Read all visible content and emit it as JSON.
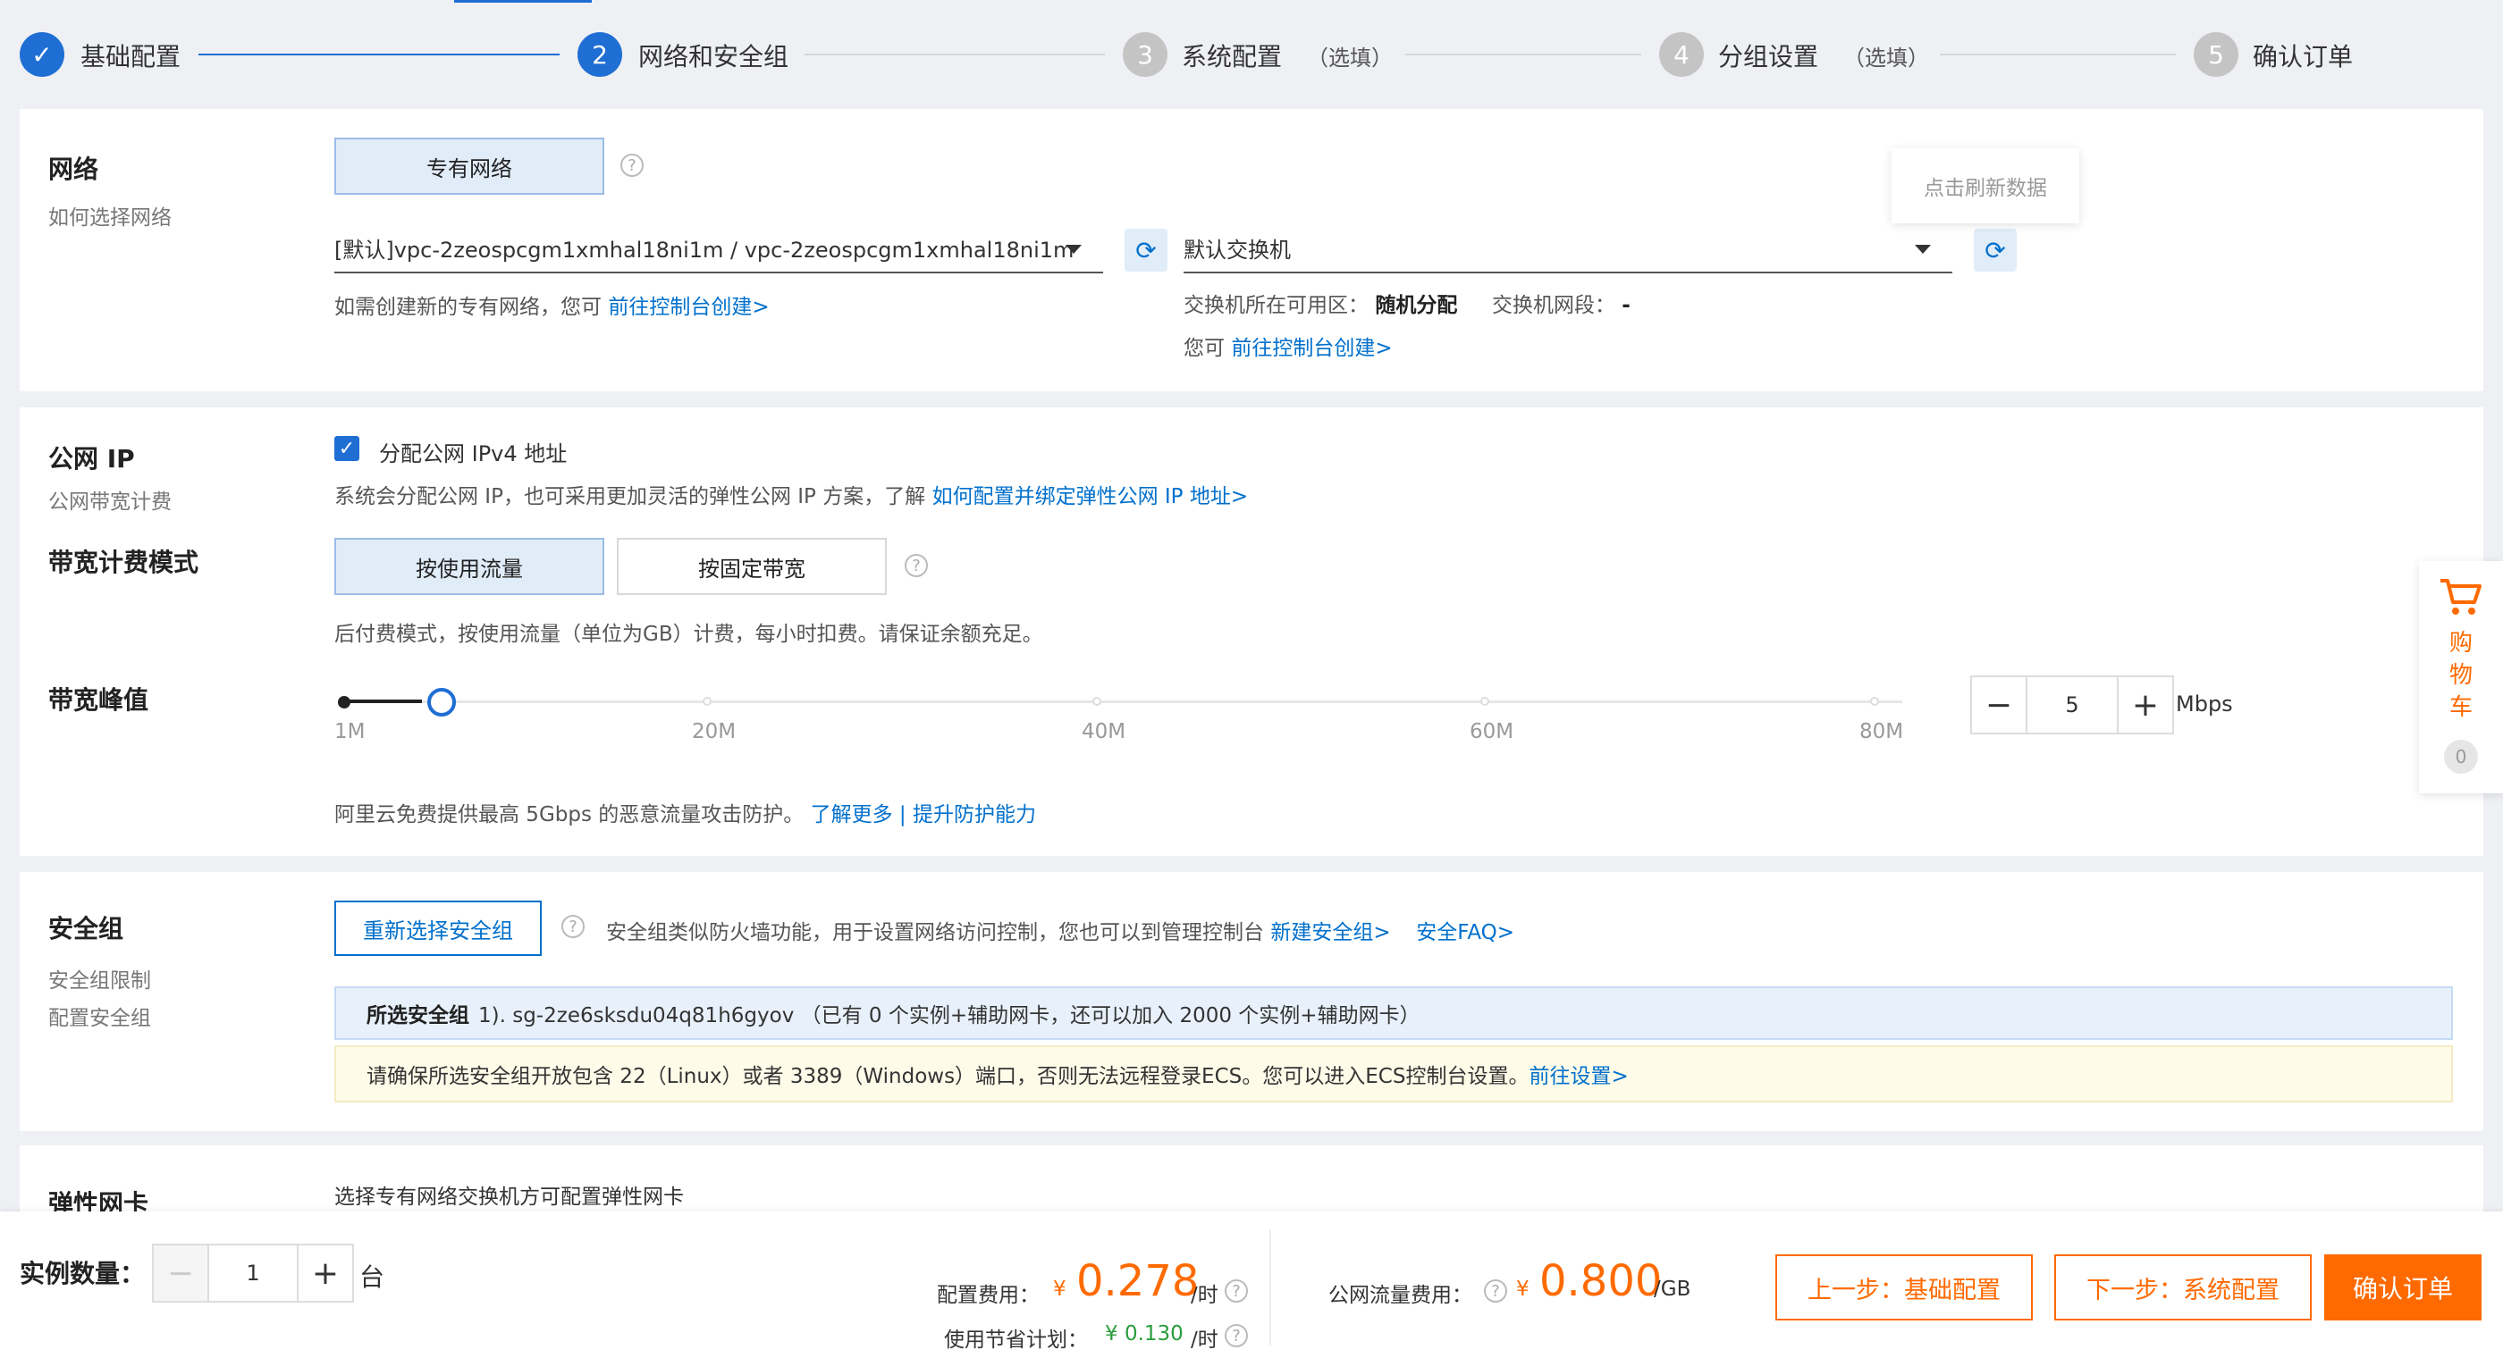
{
  "colors": {
    "brand_blue": "#0070cc",
    "brand_orange": "#ff6a00",
    "step_active": "#1f6ed4",
    "step_inactive": "#c4c4c4"
  },
  "steps": [
    {
      "num": "✓",
      "label": "基础配置",
      "optional": ""
    },
    {
      "num": "2",
      "label": "网络和安全组",
      "optional": ""
    },
    {
      "num": "3",
      "label": "系统配置",
      "optional": "（选填）"
    },
    {
      "num": "4",
      "label": "分组设置",
      "optional": "（选填）"
    },
    {
      "num": "5",
      "label": "确认订单",
      "optional": ""
    }
  ],
  "network": {
    "title": "网络",
    "subtitle": "如何选择网络",
    "type_button": "专有网络",
    "vpc_value": "[默认]vpc-2zeospcgm1xmhal18ni1m / vpc-2zeospcgm1xmhal18ni1m",
    "vpc_hint_prefix": "如需创建新的专有网络，您可",
    "vpc_hint_link": "前往控制台创建>",
    "vswitch_value": "默认交换机",
    "tooltip": "点击刷新数据",
    "zone_label": "交换机所在可用区：",
    "zone_value": "随机分配",
    "cidr_label": "交换机网段：",
    "cidr_value": "-",
    "vswitch_hint_prefix": "您可",
    "vswitch_hint_link": "前往控制台创建>"
  },
  "public_ip": {
    "title": "公网 IP",
    "subtitle": "公网带宽计费",
    "checkbox_label": "分配公网 IPv4 地址",
    "desc_prefix": "系统会分配公网 IP，也可采用更加灵活的弹性公网 IP 方案，了解",
    "desc_link": "如何配置并绑定弹性公网 IP 地址>",
    "billing_title": "带宽计费模式",
    "billing_option_1": "按使用流量",
    "billing_option_2": "按固定带宽",
    "billing_desc": "后付费模式，按使用流量（单位为GB）计费，每小时扣费。请保证余额充足。",
    "peak_title": "带宽峰值",
    "ticks": [
      "1M",
      "20M",
      "40M",
      "60M",
      "80M"
    ],
    "bandwidth_value": "5",
    "bandwidth_unit": "Mbps",
    "slider_level": 5,
    "slider_max": 80,
    "ddos_prefix": "阿里云免费提供最高 5Gbps 的恶意流量攻击防护。",
    "ddos_link": "了解更多 | 提升防护能力"
  },
  "security_group": {
    "title": "安全组",
    "subtitle_1": "安全组限制",
    "subtitle_2": "配置安全组",
    "reselect_button": "重新选择安全组",
    "desc": "安全组类似防火墙功能，用于设置网络访问控制，您也可以到管理控制台",
    "link_new": "新建安全组>",
    "link_faq": "安全FAQ>",
    "selected_label": "所选安全组",
    "selected_value": "1). sg-2ze6sksdu04q81h6gyov （已有 0 个实例+辅助网卡，还可以加入 2000 个实例+辅助网卡）",
    "warning_text": "请确保所选安全组开放包含 22（Linux）或者 3389（Windows）端口，否则无法远程登录ECS。您可以进入ECS控制台设置。",
    "warning_link": "前往设置>"
  },
  "eni": {
    "title": "弹性网卡",
    "desc": "选择专有网络交换机方可配置弹性网卡"
  },
  "cart": {
    "label_1": "购",
    "label_2": "物",
    "label_3": "车",
    "count": "0"
  },
  "footer": {
    "qty_label": "实例数量：",
    "qty_value": "1",
    "qty_unit": "台",
    "config_fee_label": "配置费用：",
    "currency": "¥",
    "config_fee_value": "0.278",
    "config_fee_unit": "/时",
    "saving_label": "使用节省计划：",
    "saving_value": "¥ 0.130",
    "saving_unit": "/时",
    "traffic_fee_label": "公网流量费用：",
    "traffic_fee_value": "0.800",
    "traffic_fee_unit": "/GB",
    "prev_button": "上一步：基础配置",
    "next_button": "下一步：系统配置",
    "confirm_button": "确认订单"
  }
}
